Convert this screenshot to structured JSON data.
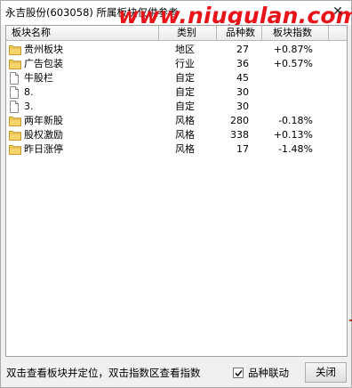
{
  "window": {
    "title": "永吉股份(603058) 所属板块仅供参考",
    "watermark": "www.niugulan.com",
    "close_glyph": "✕"
  },
  "table": {
    "columns": {
      "name": "板块名称",
      "type": "类别",
      "count": "品种数",
      "index": "板块指数"
    },
    "rows": [
      {
        "icon": "folder-icon",
        "name": "贵州板块",
        "type": "地区",
        "count": "27",
        "index": "+0.87%"
      },
      {
        "icon": "folder-icon",
        "name": "广告包装",
        "type": "行业",
        "count": "36",
        "index": "+0.57%"
      },
      {
        "icon": "document-icon",
        "name": "牛股栏",
        "type": "自定",
        "count": "45",
        "index": ""
      },
      {
        "icon": "document-icon",
        "name": "8.",
        "type": "自定",
        "count": "30",
        "index": ""
      },
      {
        "icon": "document-icon",
        "name": "3.",
        "type": "自定",
        "count": "30",
        "index": ""
      },
      {
        "icon": "folder-icon",
        "name": "两年新股",
        "type": "风格",
        "count": "280",
        "index": "-0.18%"
      },
      {
        "icon": "folder-icon",
        "name": "股权激励",
        "type": "风格",
        "count": "338",
        "index": "+0.13%"
      },
      {
        "icon": "folder-icon",
        "name": "昨日涨停",
        "type": "风格",
        "count": "17",
        "index": "-1.48%"
      }
    ]
  },
  "footer": {
    "hint": "双击查看板块并定位，双击指数区查看指数",
    "link_checkbox_label": "品种联动",
    "link_checked": true,
    "close_label": "关闭"
  },
  "colors": {
    "watermark": "#e8141a",
    "folder_fill": "#f5d46b",
    "folder_stroke": "#c89a2a"
  }
}
